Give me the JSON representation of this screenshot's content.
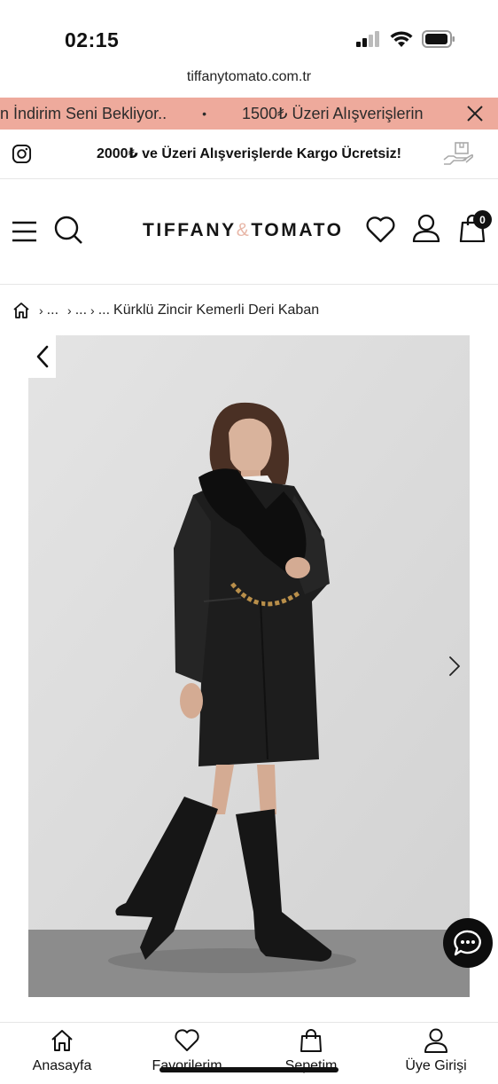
{
  "status_bar": {
    "time": "02:15"
  },
  "browser": {
    "url": "tiffanytomato.com.tr"
  },
  "promo": {
    "text_1": "n İndirim Seni Bekliyor..",
    "separator": "•",
    "text_2": "1500₺ Üzeri Alışverişlerin",
    "background": "#eeaa9c"
  },
  "shipping": {
    "text": "2000₺ ve Üzeri Alışverişlerde Kargo Ücretsiz!"
  },
  "header": {
    "logo_part_1": "TIFFANY",
    "logo_amp": "&",
    "logo_part_2": "TOMATO",
    "cart_count": "0"
  },
  "breadcrumb": {
    "items": [
      "...",
      "...",
      "..."
    ],
    "current": "Kürklü Zincir Kemerli Deri Kaban"
  },
  "bottom_nav": {
    "items": [
      {
        "label": "Anasayfa",
        "icon": "home-icon"
      },
      {
        "label": "Favorilerim",
        "icon": "heart-icon"
      },
      {
        "label": "Sepetim",
        "icon": "bag-icon"
      },
      {
        "label": "Üye Girişi",
        "icon": "user-icon"
      }
    ]
  }
}
